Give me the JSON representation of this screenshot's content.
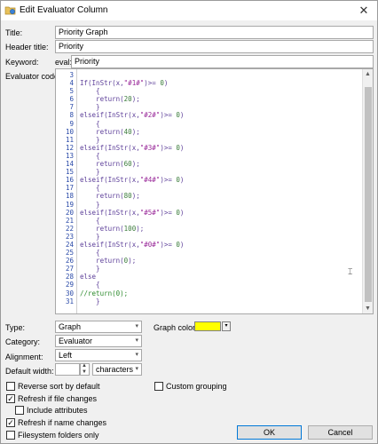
{
  "window": {
    "title": "Edit Evaluator Column",
    "close_glyph": "✕"
  },
  "fields": {
    "title_label": "Title:",
    "title_value": "Priority Graph",
    "header_label": "Header title:",
    "header_value": "Priority",
    "keyword_label": "Keyword:",
    "keyword_prefix": "eval:",
    "keyword_value": "Priority",
    "code_label": "Evaluator code:"
  },
  "code": {
    "lines": [
      {
        "n": "3",
        "t": ""
      },
      {
        "n": "4",
        "t": "If(InStr(x,\"#1#\")>= 0)"
      },
      {
        "n": "5",
        "t": "    {"
      },
      {
        "n": "6",
        "t": "    return(20);"
      },
      {
        "n": "7",
        "t": "    }"
      },
      {
        "n": "8",
        "t": "elseif(InStr(x,\"#2#\")>= 0)"
      },
      {
        "n": "9",
        "t": "    {"
      },
      {
        "n": "10",
        "t": "    return(40);"
      },
      {
        "n": "11",
        "t": "    }"
      },
      {
        "n": "12",
        "t": "elseif(InStr(x,\"#3#\")>= 0)"
      },
      {
        "n": "13",
        "t": "    {"
      },
      {
        "n": "14",
        "t": "    return(60);"
      },
      {
        "n": "15",
        "t": "    }"
      },
      {
        "n": "16",
        "t": "elseif(InStr(x,\"#4#\")>= 0)"
      },
      {
        "n": "17",
        "t": "    {"
      },
      {
        "n": "18",
        "t": "    return(80);"
      },
      {
        "n": "19",
        "t": "    }"
      },
      {
        "n": "20",
        "t": "elseif(InStr(x,\"#5#\")>= 0)"
      },
      {
        "n": "21",
        "t": "    {"
      },
      {
        "n": "22",
        "t": "    return(100);"
      },
      {
        "n": "23",
        "t": "    }"
      },
      {
        "n": "24",
        "t": "elseif(InStr(x,\"#0#\")>= 0)"
      },
      {
        "n": "25",
        "t": "    {"
      },
      {
        "n": "26",
        "t": "    return(0);"
      },
      {
        "n": "27",
        "t": "    }"
      },
      {
        "n": "28",
        "t": "else"
      },
      {
        "n": "29",
        "t": "    {"
      },
      {
        "n": "30",
        "t": "//return(0);"
      },
      {
        "n": "31",
        "t": "    }"
      }
    ]
  },
  "options": {
    "type_label": "Type:",
    "type_value": "Graph",
    "graph_color_label": "Graph color:",
    "graph_color": "#ffff00",
    "category_label": "Category:",
    "category_value": "Evaluator",
    "alignment_label": "Alignment:",
    "alignment_value": "Left",
    "default_width_label": "Default width:",
    "default_width_value": "",
    "width_unit": "characters"
  },
  "checkboxes": {
    "reverse_sort": {
      "label": "Reverse sort by default",
      "checked": false
    },
    "custom_grouping": {
      "label": "Custom grouping",
      "checked": false
    },
    "refresh_file": {
      "label": "Refresh if file changes",
      "checked": true
    },
    "include_attributes": {
      "label": "Include attributes",
      "checked": false
    },
    "refresh_name": {
      "label": "Refresh if name changes",
      "checked": true
    },
    "filesystem_only": {
      "label": "Filesystem folders only",
      "checked": false
    }
  },
  "buttons": {
    "ok": "OK",
    "cancel": "Cancel"
  },
  "icons": {
    "app": "evaluator-column-icon",
    "dropdown": "▾",
    "check": "✓",
    "spin_up": "▲",
    "spin_down": "▼",
    "scroll_up": "▲",
    "scroll_down": "▼"
  }
}
